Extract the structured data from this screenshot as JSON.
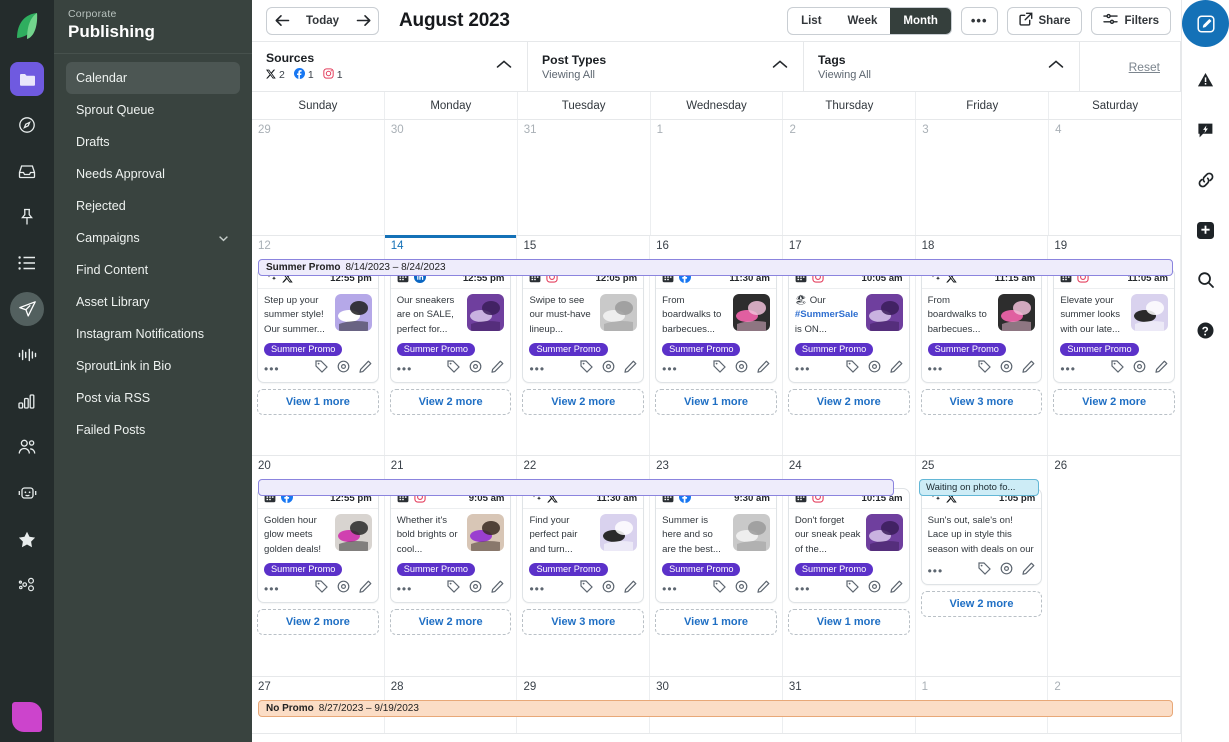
{
  "brand": {
    "logo_name": "sprout-logo",
    "accent": "#1471b7",
    "campaign_purple": "#5b31c9"
  },
  "left_rail": {
    "icons": [
      {
        "name": "folder-icon",
        "active": true
      },
      {
        "name": "dashboard-icon",
        "active": false
      },
      {
        "name": "inbox-icon",
        "active": false
      },
      {
        "name": "pin-icon",
        "active": false
      },
      {
        "name": "list-icon",
        "active": false
      },
      {
        "name": "publishing-send-icon",
        "active": true
      },
      {
        "name": "audio-waveform-icon",
        "active": false
      },
      {
        "name": "bar-chart-icon",
        "active": false
      },
      {
        "name": "people-icon",
        "active": false
      },
      {
        "name": "bot-icon",
        "active": false
      },
      {
        "name": "star-icon",
        "active": false
      },
      {
        "name": "bubbles-icon",
        "active": false
      }
    ]
  },
  "sidebar": {
    "eyebrow": "Corporate",
    "title": "Publishing",
    "items": [
      {
        "label": "Calendar",
        "selected": true,
        "expandable": false
      },
      {
        "label": "Sprout Queue",
        "selected": false,
        "expandable": false
      },
      {
        "label": "Drafts",
        "selected": false,
        "expandable": false
      },
      {
        "label": "Needs Approval",
        "selected": false,
        "expandable": false
      },
      {
        "label": "Rejected",
        "selected": false,
        "expandable": false
      },
      {
        "label": "Campaigns",
        "selected": false,
        "expandable": true
      },
      {
        "label": "Find Content",
        "selected": false,
        "expandable": false
      },
      {
        "label": "Asset Library",
        "selected": false,
        "expandable": false
      },
      {
        "label": "Instagram Notifications",
        "selected": false,
        "expandable": false
      },
      {
        "label": "SproutLink in Bio",
        "selected": false,
        "expandable": false
      },
      {
        "label": "Post via RSS",
        "selected": false,
        "expandable": false
      },
      {
        "label": "Failed Posts",
        "selected": false,
        "expandable": false
      }
    ]
  },
  "toolbar": {
    "prev_label": "previous-period",
    "today_label": "Today",
    "next_label": "next-period",
    "month_title": "August 2023",
    "views": [
      {
        "label": "List",
        "active": false
      },
      {
        "label": "Week",
        "active": false
      },
      {
        "label": "Month",
        "active": true
      }
    ],
    "more_label": "•••",
    "share_label": "Share",
    "filters_label": "Filters"
  },
  "filters": {
    "sources": {
      "label": "Sources",
      "counts": [
        {
          "network": "x-icon",
          "count": "2"
        },
        {
          "network": "facebook-icon",
          "count": "1"
        },
        {
          "network": "instagram-icon",
          "count": "1"
        }
      ]
    },
    "post_types": {
      "label": "Post Types",
      "sub": "Viewing All"
    },
    "tags": {
      "label": "Tags",
      "sub": "Viewing All"
    },
    "reset_label": "Reset"
  },
  "calendar": {
    "day_names": [
      "Sunday",
      "Monday",
      "Tuesday",
      "Wednesday",
      "Thursday",
      "Friday",
      "Saturday"
    ],
    "weeks": [
      {
        "days": [
          {
            "num": "29",
            "muted": true
          },
          {
            "num": "30",
            "muted": true
          },
          {
            "num": "31",
            "muted": true
          },
          {
            "num": "1",
            "muted": false
          },
          {
            "num": "2",
            "muted": false
          },
          {
            "num": "3",
            "muted": false
          },
          {
            "num": "4",
            "muted": false
          }
        ]
      },
      {
        "days": [
          {
            "num": "12",
            "muted": true
          },
          {
            "num": "14",
            "muted": false,
            "today": true
          },
          {
            "num": "15",
            "muted": false
          },
          {
            "num": "16",
            "muted": false
          },
          {
            "num": "17",
            "muted": false
          },
          {
            "num": "18",
            "muted": false
          },
          {
            "num": "19",
            "muted": false
          }
        ],
        "campaign": {
          "name": "Summer Promo",
          "range": "8/14/2023 – 8/24/2023",
          "style": "summer"
        },
        "posts": [
          {
            "col": 0,
            "network": "x-icon",
            "ai": true,
            "time": "12:55 pm",
            "text": "Step up your summer style! Our summer...",
            "tag": "Summer Promo",
            "thumb": "sneaker-white",
            "view_more": "View 1 more"
          },
          {
            "col": 1,
            "network": "linkedin-icon",
            "ai": false,
            "time": "12:55 pm",
            "text": "Our sneakers are on SALE, perfect for...",
            "tag": "Summer Promo",
            "thumb": "sneaker-purple",
            "view_more": "View 2 more"
          },
          {
            "col": 2,
            "network": "instagram-icon",
            "ai": false,
            "time": "12:05 pm",
            "text": "Swipe to see our must-have lineup...",
            "tag": "Summer Promo",
            "thumb": "shoe-gray",
            "view_more": "View 2 more"
          },
          {
            "col": 3,
            "network": "facebook-icon",
            "ai": false,
            "time": "11:30 am",
            "text": "From boardwalks to barbecues...",
            "tag": "Summer Promo",
            "thumb": "model-pink",
            "view_more": "View 1 more"
          },
          {
            "col": 4,
            "network": "instagram-icon",
            "ai": false,
            "time": "10:05 am",
            "text_pre": "🏖 Our ",
            "hashtag": "#SummerSale",
            "text_post": " is ON...",
            "tag": "Summer Promo",
            "thumb": "sneaker-purple",
            "view_more": "View 2 more"
          },
          {
            "col": 5,
            "network": "x-icon",
            "ai": true,
            "time": "11:15 am",
            "text": "From boardwalks to barbecues...",
            "tag": "Summer Promo",
            "thumb": "model-pink",
            "view_more": "View 3 more"
          },
          {
            "col": 6,
            "network": "instagram-icon",
            "ai": false,
            "time": "11:05 am",
            "text": "Elevate your summer looks with our late...",
            "tag": "Summer Promo",
            "thumb": "shoe-spotted",
            "view_more": "View 2 more"
          }
        ]
      },
      {
        "days": [
          {
            "num": "20",
            "muted": false
          },
          {
            "num": "21",
            "muted": false
          },
          {
            "num": "22",
            "muted": false
          },
          {
            "num": "23",
            "muted": false
          },
          {
            "num": "24",
            "muted": false
          },
          {
            "num": "25",
            "muted": false
          },
          {
            "num": "26",
            "muted": false
          }
        ],
        "campaign": {
          "name": "",
          "range": "",
          "style": "summer"
        },
        "note": "Waiting on photo fo...",
        "posts": [
          {
            "col": 0,
            "network": "facebook-icon",
            "ai": false,
            "time": "12:55 pm",
            "text": "Golden hour glow meets golden deals!",
            "tag": "Summer Promo",
            "thumb": "runner-pink",
            "view_more": "View 2 more"
          },
          {
            "col": 1,
            "network": "instagram-icon",
            "ai": false,
            "time": "9:05 am",
            "text": "Whether it's bold brights or cool...",
            "tag": "Summer Promo",
            "thumb": "runner-tan",
            "view_more": "View 2 more"
          },
          {
            "col": 2,
            "network": "x-icon",
            "ai": true,
            "time": "11:30 am",
            "text": "Find your perfect pair and turn...",
            "tag": "Summer Promo",
            "thumb": "shoe-spotted",
            "view_more": "View 3 more"
          },
          {
            "col": 3,
            "network": "facebook-icon",
            "ai": false,
            "time": "9:30 am",
            "text": "Summer is here and so are the best...",
            "tag": "Summer Promo",
            "thumb": "shoe-gray",
            "view_more": "View 1 more"
          },
          {
            "col": 4,
            "network": "instagram-icon",
            "ai": false,
            "time": "10:15 am",
            "text": "Don't forget our sneak peak of the...",
            "tag": "Summer Promo",
            "thumb": "sneaker-purple",
            "view_more": "View 1 more"
          },
          {
            "col": 5,
            "network": "x-icon",
            "ai": true,
            "time": "1:05 pm",
            "text": "Sun's out, sale's on! Lace up in style this season with deals on our hottest sneakers.",
            "tag": "",
            "thumb": "",
            "view_more": "View 2 more"
          }
        ]
      },
      {
        "days": [
          {
            "num": "27",
            "muted": false
          },
          {
            "num": "28",
            "muted": false
          },
          {
            "num": "29",
            "muted": false
          },
          {
            "num": "30",
            "muted": false
          },
          {
            "num": "31",
            "muted": false
          },
          {
            "num": "1",
            "muted": true
          },
          {
            "num": "2",
            "muted": true
          }
        ],
        "campaign": {
          "name": "No Promo",
          "range": "8/27/2023 – 9/19/2023",
          "style": "nopromo"
        }
      }
    ]
  },
  "right_rail": {
    "compose_label": "compose-post",
    "icons": [
      {
        "name": "alert-icon"
      },
      {
        "name": "feedback-bubble-icon"
      },
      {
        "name": "link-icon"
      },
      {
        "name": "add-square-icon"
      },
      {
        "name": "search-icon"
      },
      {
        "name": "help-icon"
      }
    ]
  }
}
